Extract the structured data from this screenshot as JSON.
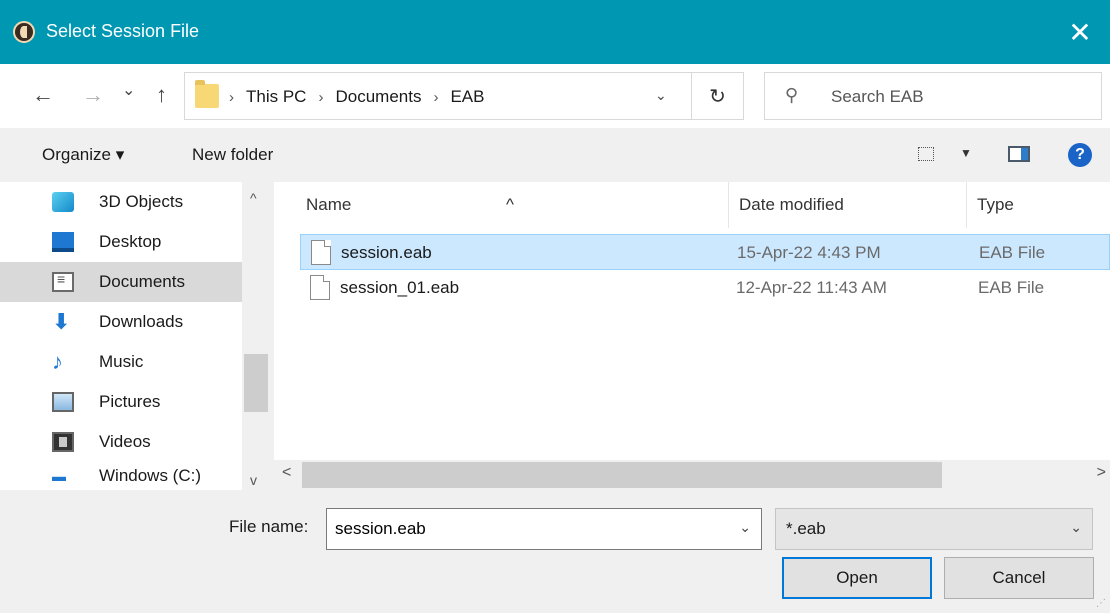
{
  "window": {
    "title": "Select Session File",
    "close_glyph": "✕",
    "app_icon": "eab-app-icon"
  },
  "nav": {
    "back": "←",
    "forward": "→",
    "recent": "⌄",
    "up": "↑"
  },
  "address": {
    "crumbs": [
      "This PC",
      "Documents",
      "EAB"
    ],
    "separator": "›",
    "dropdown": "⌄",
    "refresh": "↻"
  },
  "search": {
    "placeholder": "Search EAB",
    "icon": "⚲"
  },
  "toolbar": {
    "organize_label": "Organize ▾",
    "new_folder_label": "New folder",
    "view_dd": "▼",
    "help": "?"
  },
  "sidebar": {
    "items": [
      {
        "label": "3D Objects",
        "icon": "3d-objects-icon"
      },
      {
        "label": "Desktop",
        "icon": "desktop-icon"
      },
      {
        "label": "Documents",
        "icon": "documents-icon",
        "selected": true
      },
      {
        "label": "Downloads",
        "icon": "downloads-icon"
      },
      {
        "label": "Music",
        "icon": "music-icon"
      },
      {
        "label": "Pictures",
        "icon": "pictures-icon"
      },
      {
        "label": "Videos",
        "icon": "videos-icon"
      },
      {
        "label": "Windows (C:)",
        "icon": "drive-icon"
      }
    ],
    "scroll_up": "^",
    "scroll_down": "v"
  },
  "files": {
    "columns": {
      "name": "Name",
      "date": "Date modified",
      "type": "Type",
      "sort_arrow": "^"
    },
    "rows": [
      {
        "name": "session.eab",
        "date": "15-Apr-22 4:43 PM",
        "type": "EAB File",
        "selected": true
      },
      {
        "name": "session_01.eab",
        "date": "12-Apr-22 11:43 AM",
        "type": "EAB File",
        "selected": false
      }
    ],
    "scroll_left": "<",
    "scroll_right": ">"
  },
  "footer": {
    "file_name_label": "File name:",
    "file_name_value": "session.eab",
    "file_type_value": "*.eab",
    "dropdown": "⌄",
    "open_label": "Open",
    "cancel_label": "Cancel"
  },
  "colors": {
    "titlebar": "#0097b2",
    "selection": "#cce8ff",
    "accent": "#0078d7"
  }
}
